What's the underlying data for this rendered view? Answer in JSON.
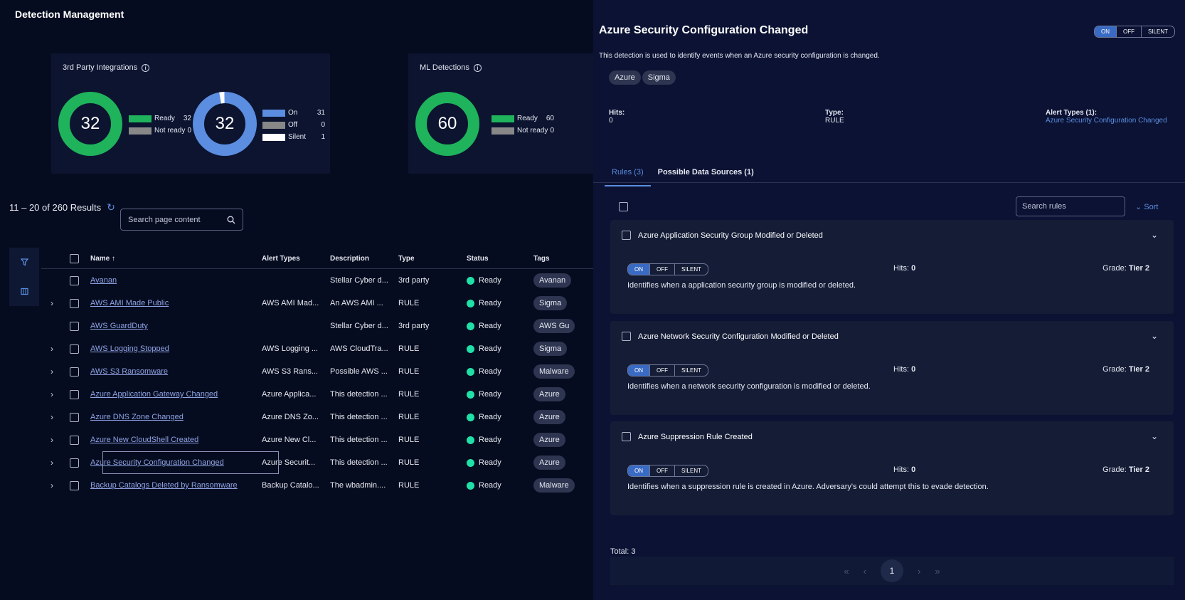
{
  "page_title": "Detection Management",
  "cards": {
    "third_party": {
      "title": "3rd Party Integrations",
      "donut1": {
        "value": "32",
        "legend": [
          {
            "label": "Ready",
            "value": "32",
            "color": "#1fb35c"
          },
          {
            "label": "Not ready",
            "value": "0",
            "color": "#888888"
          }
        ]
      },
      "donut2": {
        "value": "32",
        "legend": [
          {
            "label": "On",
            "value": "31",
            "color": "#5b8de0"
          },
          {
            "label": "Off",
            "value": "0",
            "color": "#888888"
          },
          {
            "label": "Silent",
            "value": "1",
            "color": "#ffffff"
          }
        ]
      }
    },
    "ml": {
      "title": "ML Detections",
      "donut1": {
        "value": "60",
        "legend": [
          {
            "label": "Ready",
            "value": "60",
            "color": "#1fb35c"
          },
          {
            "label": "Not ready",
            "value": "0",
            "color": "#888888"
          }
        ]
      }
    }
  },
  "results": {
    "text": "11 – 20 of 260 Results",
    "search_placeholder": "Search page content"
  },
  "table": {
    "headers": {
      "name": "Name",
      "alert_types": "Alert Types",
      "description": "Description",
      "type": "Type",
      "status": "Status",
      "tags": "Tags"
    },
    "rows": [
      {
        "name": "Avanan",
        "alert": "",
        "desc": "Stellar Cyber d...",
        "type": "3rd party",
        "status": "Ready",
        "tag": "Avanan",
        "expand": ""
      },
      {
        "name": "AWS AMI Made Public",
        "alert": "AWS AMI Mad...",
        "desc": "An AWS AMI ...",
        "type": "RULE",
        "status": "Ready",
        "tag": "Sigma",
        "expand": "›"
      },
      {
        "name": "AWS GuardDuty",
        "alert": "",
        "desc": "Stellar Cyber d...",
        "type": "3rd party",
        "status": "Ready",
        "tag": "AWS Gu",
        "expand": ""
      },
      {
        "name": "AWS Logging Stopped",
        "alert": "AWS Logging ...",
        "desc": "AWS CloudTra...",
        "type": "RULE",
        "status": "Ready",
        "tag": "Sigma",
        "expand": "›"
      },
      {
        "name": "AWS S3 Ransomware",
        "alert": "AWS S3 Rans...",
        "desc": "Possible AWS ...",
        "type": "RULE",
        "status": "Ready",
        "tag": "Malware",
        "expand": "›"
      },
      {
        "name": "Azure Application Gateway Changed",
        "alert": "Azure Applica...",
        "desc": "This detection ...",
        "type": "RULE",
        "status": "Ready",
        "tag": "Azure",
        "expand": "›"
      },
      {
        "name": "Azure DNS Zone Changed",
        "alert": "Azure DNS Zo...",
        "desc": "This detection ...",
        "type": "RULE",
        "status": "Ready",
        "tag": "Azure",
        "expand": "›"
      },
      {
        "name": "Azure New CloudShell Created",
        "alert": "Azure New Cl...",
        "desc": "This detection ...",
        "type": "RULE",
        "status": "Ready",
        "tag": "Azure",
        "expand": "›"
      },
      {
        "name": "Azure Security Configuration Changed",
        "alert": "Azure Securit...",
        "desc": "This detection ...",
        "type": "RULE",
        "status": "Ready",
        "tag": "Azure",
        "expand": "›"
      },
      {
        "name": "Backup Catalogs Deleted by Ransomware",
        "alert": "Backup Catalo...",
        "desc": "The wbadmin....",
        "type": "RULE",
        "status": "Ready",
        "tag": "Malware",
        "expand": "›"
      }
    ]
  },
  "panel": {
    "title": "Azure Security Configuration Changed",
    "toggle": {
      "on": "ON",
      "off": "OFF",
      "silent": "SILENT"
    },
    "description": "This detection is used to identify events when an Azure security configuration is changed.",
    "tags": [
      "Azure",
      "Sigma"
    ],
    "hits_label": "Hits:",
    "hits_value": "0",
    "type_label": "Type:",
    "type_value": "RULE",
    "alert_types_label": "Alert Types (1):",
    "alert_types_value": "Azure Security Configuration Changed",
    "tabs": [
      "Rules (3)",
      "Possible Data Sources (1)"
    ],
    "search_placeholder": "Search rules",
    "sort_label": "Sort",
    "rules": [
      {
        "title": "Azure Application Security Group Modified or Deleted",
        "hits_label": "Hits:",
        "hits": "0",
        "grade_label": "Grade:",
        "grade": "Tier 2",
        "desc": "Identifies when a application security group is modified or deleted."
      },
      {
        "title": "Azure Network Security Configuration Modified or Deleted",
        "hits_label": "Hits:",
        "hits": "0",
        "grade_label": "Grade:",
        "grade": "Tier 2",
        "desc": "Identifies when a network security configuration is modified or deleted."
      },
      {
        "title": "Azure Suppression Rule Created",
        "hits_label": "Hits:",
        "hits": "0",
        "grade_label": "Grade:",
        "grade": "Tier 2",
        "desc": "Identifies when a suppression rule is created in Azure. Adversary's could attempt this to evade detection."
      }
    ],
    "total": "Total: 3",
    "page": "1"
  }
}
